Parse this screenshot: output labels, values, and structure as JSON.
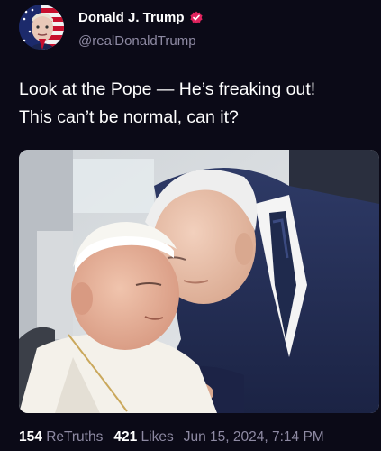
{
  "post": {
    "author": {
      "display_name": "Donald J. Trump",
      "handle": "@realDonaldTrump",
      "verified": true,
      "verified_color": "#e0245e",
      "avatar_icon": "flag-portrait-avatar"
    },
    "text_lines": [
      "Look at the Pope — He’s freaking out!",
      "This can’t be normal, can it?"
    ],
    "media": {
      "icon": "photo-image"
    },
    "stats": {
      "retruths_count": "154",
      "retruths_label": "ReTruths",
      "likes_count": "421",
      "likes_label": "Likes",
      "timestamp": "Jun 15, 2024, 7:14 PM"
    }
  },
  "colors": {
    "background": "#0b0a17",
    "secondary_text": "#8e8aa3"
  }
}
